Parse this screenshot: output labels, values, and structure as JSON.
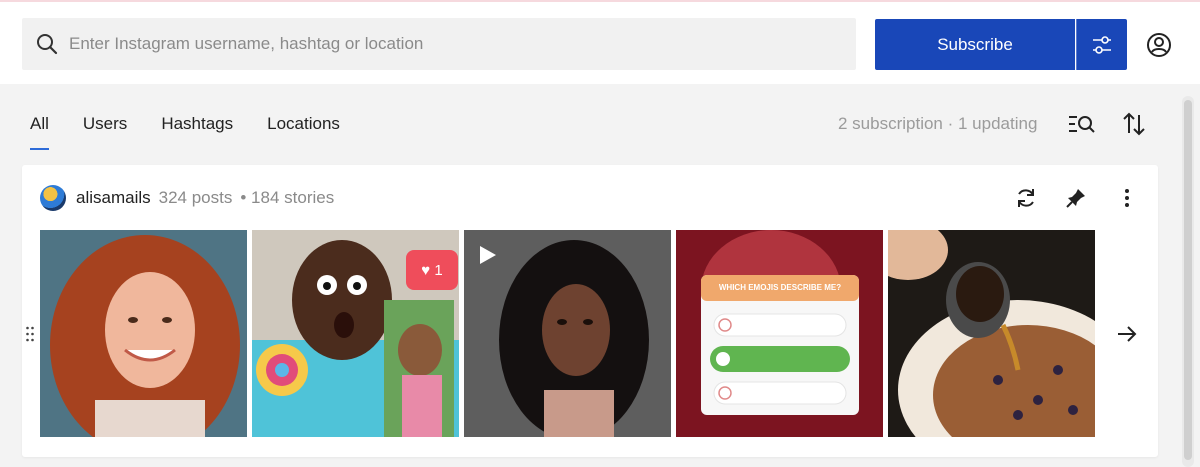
{
  "search": {
    "placeholder": "Enter Instagram username, hashtag or location",
    "value": ""
  },
  "header": {
    "subscribe_label": "Subscribe"
  },
  "tabs": [
    {
      "label": "All",
      "active": true
    },
    {
      "label": "Users",
      "active": false
    },
    {
      "label": "Hashtags",
      "active": false
    },
    {
      "label": "Locations",
      "active": false
    }
  ],
  "summary": "2 subscription · 1 updating",
  "card": {
    "username": "alisamails",
    "posts": "324 posts",
    "stories": "• 184 stories",
    "thumbnails": [
      {
        "alt": "portrait of woman with red curly hair"
      },
      {
        "alt": "surprised man with lollipop, notification badge",
        "badge": "1"
      },
      {
        "alt": "video thumbnail of woman",
        "is_video": true
      },
      {
        "alt": "story poll",
        "poll_title": "WHICH EMOJIS DESCRIBE ME?"
      },
      {
        "alt": "coffee poured over dessert"
      }
    ]
  },
  "colors": {
    "accent": "#1947b8",
    "tab_underline": "#2d6bd8",
    "muted_text": "#9b9b9b",
    "page_bg": "#f3f3f3"
  }
}
